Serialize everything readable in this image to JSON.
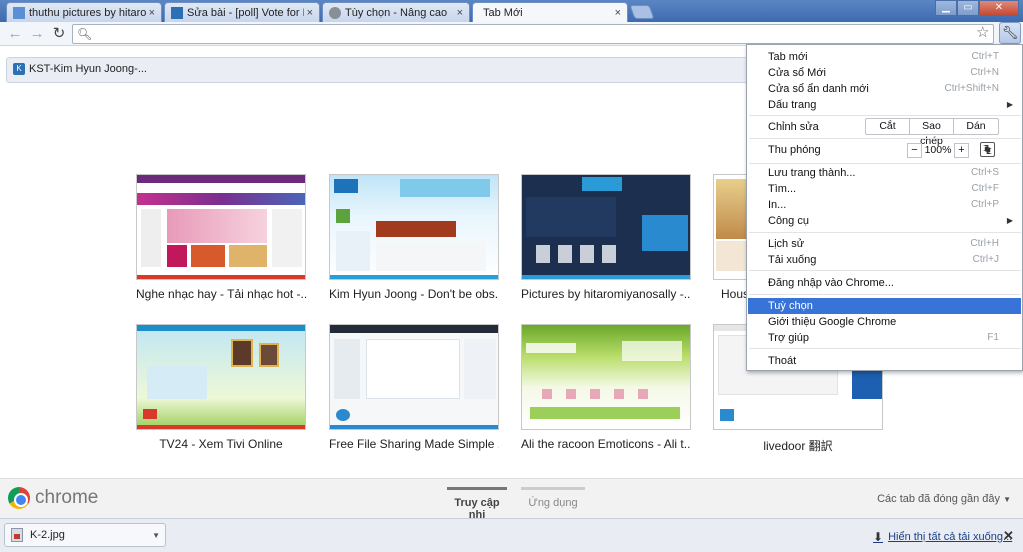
{
  "tabs": [
    {
      "title": "thuthu pictures by hitaromiyanosally",
      "active": false
    },
    {
      "title": "Sửa bài - [poll] Vote for Kim Hyun Joong",
      "active": false
    },
    {
      "title": "Tùy chọn - Nâng cao",
      "active": false
    },
    {
      "title": "Tab Mới",
      "active": true
    }
  ],
  "bookmark_bar": {
    "items": [
      {
        "label": "KST-Kim Hyun Joong-..."
      }
    ]
  },
  "most_visited": [
    {
      "caption": "Nghe nhạc hay - Tải nhạc hot -..."
    },
    {
      "caption": "Kim Hyun Joong - Don't be obs..."
    },
    {
      "caption": "Pictures by hitaromiyanosally -..."
    },
    {
      "caption": "Hous"
    },
    {
      "caption": "TV24 - Xem Tivi Online"
    },
    {
      "caption": "Free File Sharing Made Simple ..."
    },
    {
      "caption": "Ali the racoon Emoticons - Ali t..."
    },
    {
      "caption": "livedoor 翻訳"
    }
  ],
  "footer": {
    "logo_text": "chrome",
    "page_tabs": [
      {
        "label": "Truy cập nhi",
        "selected": true
      },
      {
        "label": "Ứng dụng",
        "selected": false
      }
    ],
    "recently_closed": "Các tab đã đóng gần đây"
  },
  "downloads": {
    "item": "K-2.jpg",
    "show_all": "Hiển thị tất cả tải xuống..."
  },
  "menu": {
    "new_tab": {
      "label": "Tab mới",
      "shortcut": "Ctrl+T"
    },
    "new_window": {
      "label": "Cửa sổ Mới",
      "shortcut": "Ctrl+N"
    },
    "incognito": {
      "label": "Cửa sổ ẩn danh mới",
      "shortcut": "Ctrl+Shift+N"
    },
    "bookmarks": {
      "label": "Dấu trang"
    },
    "edit": {
      "label": "Chỉnh sửa",
      "cut": "Cắt",
      "copy": "Sao chép",
      "paste": "Dán"
    },
    "zoom": {
      "label": "Thu phóng",
      "minus": "−",
      "value": "100%",
      "plus": "+"
    },
    "save_page": {
      "label": "Lưu trang thành...",
      "shortcut": "Ctrl+S"
    },
    "find": {
      "label": "Tìm...",
      "shortcut": "Ctrl+F"
    },
    "print": {
      "label": "In...",
      "shortcut": "Ctrl+P"
    },
    "tools": {
      "label": "Công cụ"
    },
    "history": {
      "label": "Lịch sử",
      "shortcut": "Ctrl+H"
    },
    "downloads": {
      "label": "Tải xuống",
      "shortcut": "Ctrl+J"
    },
    "sign_in": {
      "label": "Đăng nhập vào Chrome..."
    },
    "settings": {
      "label": "Tuỳ chọn"
    },
    "about": {
      "label": "Giới thiệu Google Chrome"
    },
    "help": {
      "label": "Trợ giúp",
      "shortcut": "F1"
    },
    "exit": {
      "label": "Thoát"
    }
  },
  "colors": {
    "highlight": "#3874d8",
    "accent_tab": "#3d6bb0"
  }
}
